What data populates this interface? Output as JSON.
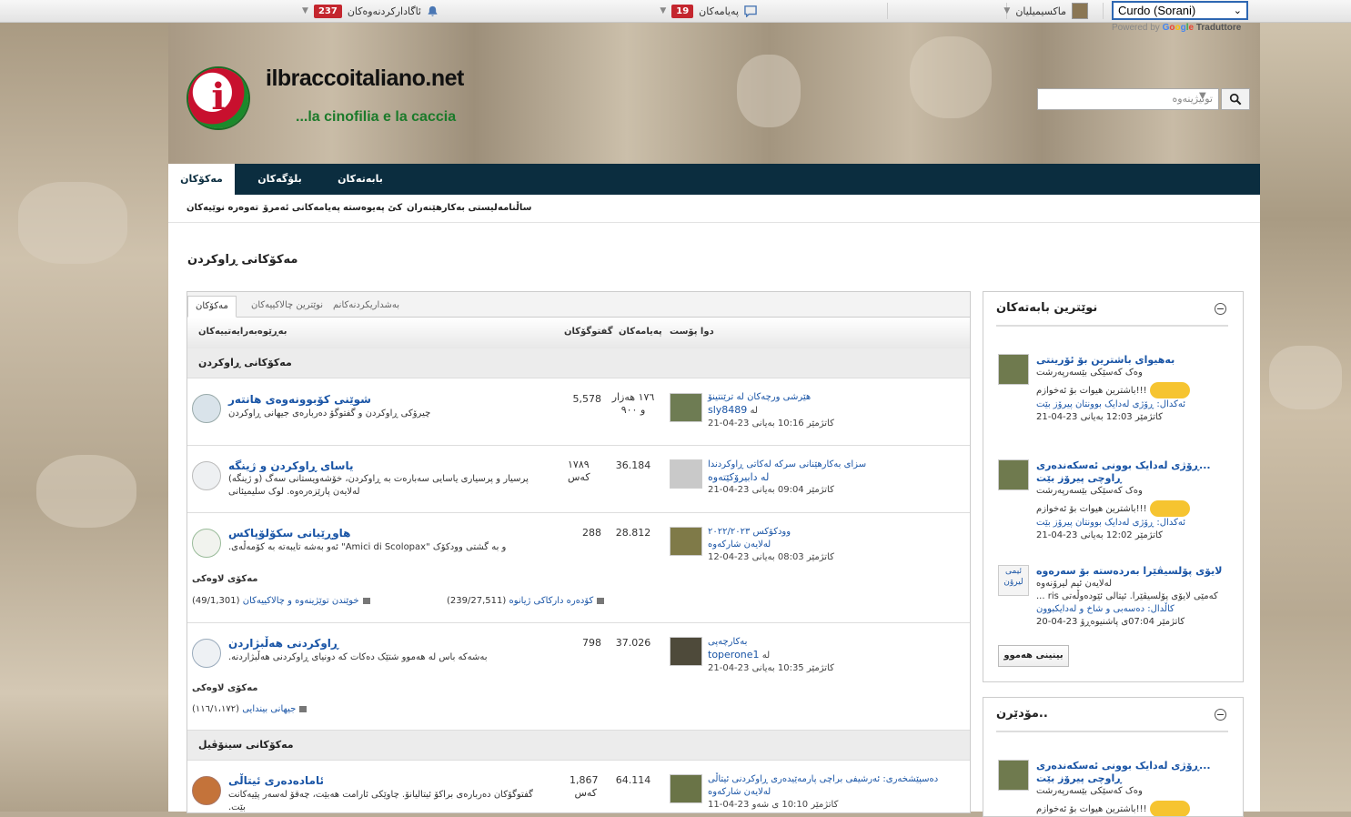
{
  "topbar": {
    "lang_select": "Curdo (Sorani)",
    "user_name": "ماکسیمیلیان",
    "messages_label": "پەیامەکان",
    "messages_count": "19",
    "notifications_label": "ئاگادارکردنەوەکان",
    "notifications_count": "237",
    "powered_by": "Powered by",
    "translate_brand": "Traduttore"
  },
  "header": {
    "site_name": "ilbraccoitaliano.net",
    "tagline": "...la cinofilia e la caccia",
    "logo_letter": "i",
    "search_placeholder": "تونیژینەوە"
  },
  "nav": {
    "tabs": [
      "مەکۆکان",
      "بلۆگەکان",
      "بابەتەکان"
    ],
    "sub": [
      "تەوەرە نوێیەکان",
      "پەیامەکانی ئەمرۆ",
      "کێ پەیوەستە",
      "لیستی بەکارهێنەران",
      "ساڵنامە"
    ]
  },
  "page_title": "مەکۆکانی ڕاوکردن",
  "forum": {
    "tabs": [
      "مەکۆکان",
      "نوێترین چالاکییەکان",
      "بەشداریکردنەکانم"
    ],
    "headers": {
      "forum": "بەڕێوەبەرایەتییەکان",
      "topics": "گفتوگۆکان",
      "posts": "پەیامەکان",
      "last": "دوا پۆست"
    },
    "categories": [
      "مەکۆکانی ڕاوکردن",
      "مەکۆکانی سینۆڤیل"
    ],
    "subforums_label": "مەکۆی لاوەکی",
    "rows": [
      {
        "title": "شوێنی کۆبوونەوەی هانتەر",
        "desc": "چیرۆکی ڕاوکردن و گفتوگۆ دەربارەی جیهانی ڕاوکردن",
        "topics": "5,578",
        "posts": "١٧٦ هەزار و ٩٠٠",
        "last_title": "هێرشی ورچەکان لە ترێنتینۆ",
        "last_user_prefix": "لە",
        "last_user": "sly8489",
        "last_date": "کاتژمێر 10:16 بەیانی ‎21-04-23"
      },
      {
        "title": "یاسای ڕاوکردن و ژینگە",
        "desc": "پرسیار و پرسیاری یاسایی سەبارەت بە ڕاوکردن، خۆشەویستانی سەگ (و ژینگە) لەلایەن پارێزەرەوە. لوک سلیمیئانی",
        "topics": "١٧٨٩ کەس",
        "posts": "36.184",
        "last_title": "سزای بەکارهێنانی سرکە لەکاتی ڕاوکردندا",
        "last_user_prefix": "",
        "last_user": "لە دابیرۆکێتەوە",
        "last_date": "کاتژمێر 09:04 بەیانی ‎21-04-23"
      },
      {
        "title": "هاوڕێیانی سکۆلۆپاکس",
        "desc": "و بە گشتی وودکۆک \"Amici di Scolopax\" ئەو بەشە تایبەتە بە کۆمەڵەی.",
        "topics": "288",
        "posts": "28.812",
        "last_title": "وودکۆکس ٢٠٢٢/٢٠٢٣",
        "last_user_prefix": "",
        "last_user": "لەلایەن شارکەوە",
        "last_date": "کاتژمێر 08:03 بەیانی ‎12-04-23",
        "subforums": [
          {
            "name": "کۆدەرە دارکاکی ژیانوە",
            "count": "(239/27,511)"
          },
          {
            "name": "خوێندن توێژینەوە و چالاکییەکان",
            "count": "(49/1,301)"
          }
        ]
      },
      {
        "title": "ڕاوکردنی هەڵبژاردن",
        "desc": "بەشەکە باس لە هەموو شتێک دەکات کە دونیای ڕاوکردنی هەڵبژاردنە.",
        "topics": "798",
        "posts": "37.026",
        "last_title": "بەکارچەپی",
        "last_user_prefix": "لە",
        "last_user": "toperone1",
        "last_date": "کاتژمێر 10:35 بەیانی ‎21-04-23",
        "subforums": [
          {
            "name": "جیهانی بیندایی",
            "count": "(١١٦/١،١٧٢)"
          }
        ]
      },
      {
        "title": "ئامادەدەری ئیتاڵی",
        "desc": "گفتوگۆکان دەربارەی براکۆ ئیتالیانۆ. چاوێکی ئارامت هەبێت، چەقۆ لەسەر پێیەکانت بێت.",
        "topics": "1,867 کەس",
        "posts": "64.114",
        "last_title": "دەسپێشخەری: ئەرشیفی براچی پارمەێیدەری ڕاوکردنی ئیتاڵی",
        "last_user_prefix": "",
        "last_user": "لەلایەن شارکەوە",
        "last_date": "کاتژمێر 10:10 ی شەو ‎11-04-23"
      }
    ]
  },
  "sidebar": {
    "latest_title": "نوێترین بابەتەکان",
    "latest_items": [
      {
        "title": "بەهیوای باشترین بۆ ئۆرینتی",
        "user": "وەک کەسێکی بێسەرپەرشت",
        "text": "!!!باشترین هیوات بۆ ئەخوازم",
        "last": "ئەکدال: ڕۆژی لەدایک بوونتان پیرۆز بێت",
        "date": "کاتژمێر 12:03 بەیانی ‎21-04-23"
      },
      {
        "title": "...ڕۆژی لەدایک بوونی ئەسکەندەری ڕاوچی پیرۆز بێت",
        "user": "وەک کەسێکی بێسەرپەرشت",
        "text": "!!!باشترین هیوات بۆ ئەخوازم",
        "last": "ئەکدال: ڕۆژی لەدایک بوونتان پیرۆز بێت",
        "date": "کاتژمێر 12:02 بەیانی ‎21-04-23"
      },
      {
        "title": "لایۆی پۆلسیڤێرا بەردەستە بۆ سەرەوە",
        "user": "لەلایەن ئیم لیرۆنەوە",
        "text": "کەمێی لایۆی پۆلسیڤێرا. ئیتالی ئێودەوڵەتی ris ...",
        "last": "کاڵدال: دەسەبی و شاخ و لەدایکبوون",
        "date": "کاتژمێر 07:04ی پاشنیوەڕۆ ‎20-04-23",
        "avatar_alt": "ئیمی لیرۆن"
      }
    ],
    "see_all": "بینینی هەموو",
    "welcome_title": "..مۆدێرن",
    "welcome_items": [
      {
        "title": "...ڕۆژی لەدایک بوونی ئەسکەندەری ڕاوچی پیرۆز بێت",
        "user": "وەک کەسێکی بێسەرپەرشت",
        "text": "!!!باشترین هیوات بۆ ئەخوازم"
      }
    ]
  },
  "colors": {
    "nav_bg": "#0b2d3f",
    "link": "#1a55a6",
    "badge": "#c4262e",
    "tagline": "#1b7a2a"
  }
}
